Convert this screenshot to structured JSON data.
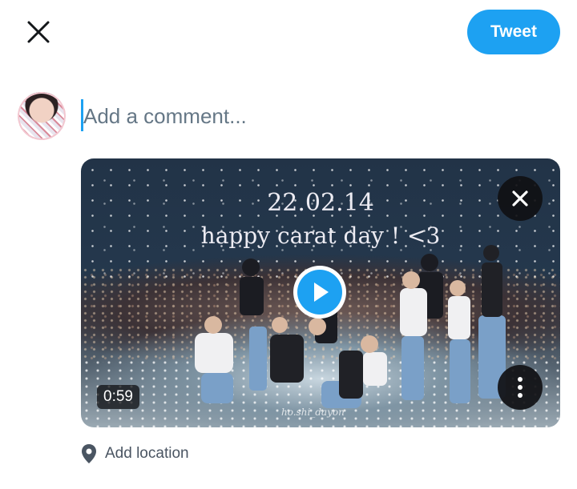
{
  "header": {
    "tweet_label": "Tweet",
    "close_icon": "close-icon"
  },
  "composer": {
    "placeholder": "Add a comment...",
    "value": "",
    "avatar_alt": "user avatar"
  },
  "media": {
    "overlay_line1": "22.02.14",
    "overlay_line2": "happy carat day ! <3",
    "watermark": "ho.shi_dayon",
    "duration": "0:59",
    "play_icon": "play-icon",
    "remove_icon": "close-icon",
    "more_icon": "more-vertical-icon"
  },
  "footer": {
    "location_label": "Add location",
    "location_icon": "location-pin-icon"
  },
  "colors": {
    "accent": "#1da1f2",
    "text": "#14171a",
    "muted": "#657786"
  }
}
